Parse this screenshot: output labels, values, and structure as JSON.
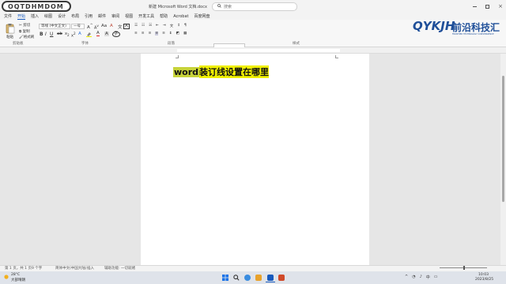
{
  "title_bar": {
    "logo_text": "OQTDHMDOM",
    "doc_title": "新建 Microsoft Word 文档.docx",
    "search_placeholder": "搜索"
  },
  "menu": {
    "tabs": [
      "文件",
      "开始",
      "插入",
      "绘图",
      "设计",
      "布局",
      "引用",
      "邮件",
      "审阅",
      "视图",
      "开发工具",
      "帮助",
      "Acrobat",
      "百度网盘"
    ],
    "active": "开始"
  },
  "ribbon": {
    "clipboard": {
      "paste_label": "粘贴",
      "label": "剪贴板",
      "cut": "剪切",
      "copy": "复制",
      "format_painter": "格式刷"
    },
    "font": {
      "font_name": "等线 (中文正文)",
      "font_size": "一号",
      "label": "字体"
    },
    "paragraph": {
      "label": "段落"
    },
    "styles": {
      "label": "样式",
      "items": [
        "正文",
        "无间隔",
        "标题 1",
        "标题 2",
        "标题",
        "副"
      ]
    }
  },
  "brand": {
    "latin": "QYKJH",
    "chinese": "前沿科技汇",
    "tagline": "FRONTIER TECHNOLOGY CONVERGENCE"
  },
  "document": {
    "heading_part1": "word",
    "heading_part2": " 装订线设置在哪里"
  },
  "status_bar": {
    "page": "第 1 页，共 1 页",
    "words": "9 个字",
    "language": "简体中文(中国大陆)",
    "insert_mode": "插入",
    "accessibility": "辅助功能: 一切就绪"
  },
  "taskbar": {
    "weather_temp": "28°C",
    "weather_desc": "大部晴朗",
    "time": "10:03",
    "date": "2023/8/25"
  },
  "colors": {
    "accent": "#185abd",
    "highlight_green": "#c7d33a",
    "highlight_yellow": "#f0f000",
    "brand": "#1f4f99"
  }
}
